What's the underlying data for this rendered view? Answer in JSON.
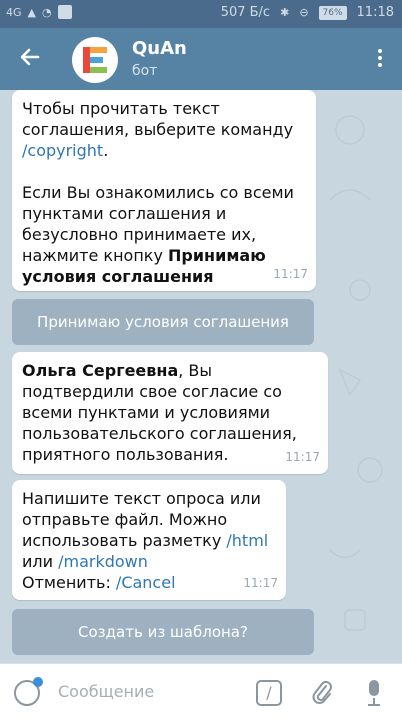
{
  "status_bar": {
    "network": "4G",
    "speed": "507 Б/с",
    "battery": "76%",
    "time": "11:18"
  },
  "header": {
    "title": "QuAn",
    "subtitle": "бот"
  },
  "messages": [
    {
      "part1": "Чтобы прочитать текст соглашения, выберите команду ",
      "cmd": "/copyright",
      "part1_end": ".",
      "part2": "Если Вы ознакомились со всеми пунктами соглашения и безусловно принимаете их, нажмите кнопку ",
      "part2_bold": "Принимаю условия соглашения",
      "time": "11:17"
    },
    {
      "bold": "Ольга Сергеевна",
      "text": ", Вы подтвердили свое согласие со всеми пунктами и условиями пользовательского соглашения, приятного пользования.",
      "time": "11:17"
    },
    {
      "text1": "Напишите текст опроса или отправьте файл. Можно использовать разметку ",
      "cmd1": "/html",
      "or": " или ",
      "cmd2": "/markdown",
      "cancel_label": "Отменить: ",
      "cmd3": "/Cancel",
      "time": "11:17"
    }
  ],
  "keyboard_buttons": [
    "Принимаю условия соглашения",
    "Создать из шаблона?"
  ],
  "input": {
    "placeholder": "Сообщение"
  },
  "colors": {
    "app_bar": "#5682a3",
    "status_bar": "#4a6b8c",
    "link": "#2f77b5",
    "chat_bg": "#c8d6e0"
  }
}
